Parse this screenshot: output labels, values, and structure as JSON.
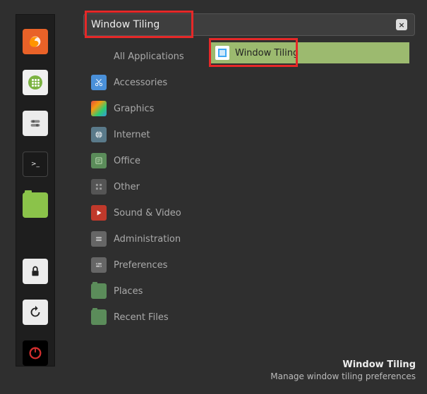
{
  "search": {
    "value": "Window Tiling"
  },
  "launcher": [
    {
      "name": "firefox"
    },
    {
      "name": "apps"
    },
    {
      "name": "settings"
    },
    {
      "name": "terminal"
    },
    {
      "name": "files"
    },
    {
      "name": "lock"
    },
    {
      "name": "restart"
    },
    {
      "name": "power"
    }
  ],
  "categories": [
    {
      "label": "All Applications",
      "icon": "none"
    },
    {
      "label": "Accessories",
      "icon": "scissors"
    },
    {
      "label": "Graphics",
      "icon": "graphics"
    },
    {
      "label": "Internet",
      "icon": "internet"
    },
    {
      "label": "Office",
      "icon": "office"
    },
    {
      "label": "Other",
      "icon": "other"
    },
    {
      "label": "Sound & Video",
      "icon": "sound"
    },
    {
      "label": "Administration",
      "icon": "admin"
    },
    {
      "label": "Preferences",
      "icon": "prefs"
    },
    {
      "label": "Places",
      "icon": "places"
    },
    {
      "label": "Recent Files",
      "icon": "recent"
    }
  ],
  "result": {
    "label": "Window Tiling"
  },
  "tooltip": {
    "title": "Window Tiling",
    "desc": "Manage window tiling preferences"
  }
}
